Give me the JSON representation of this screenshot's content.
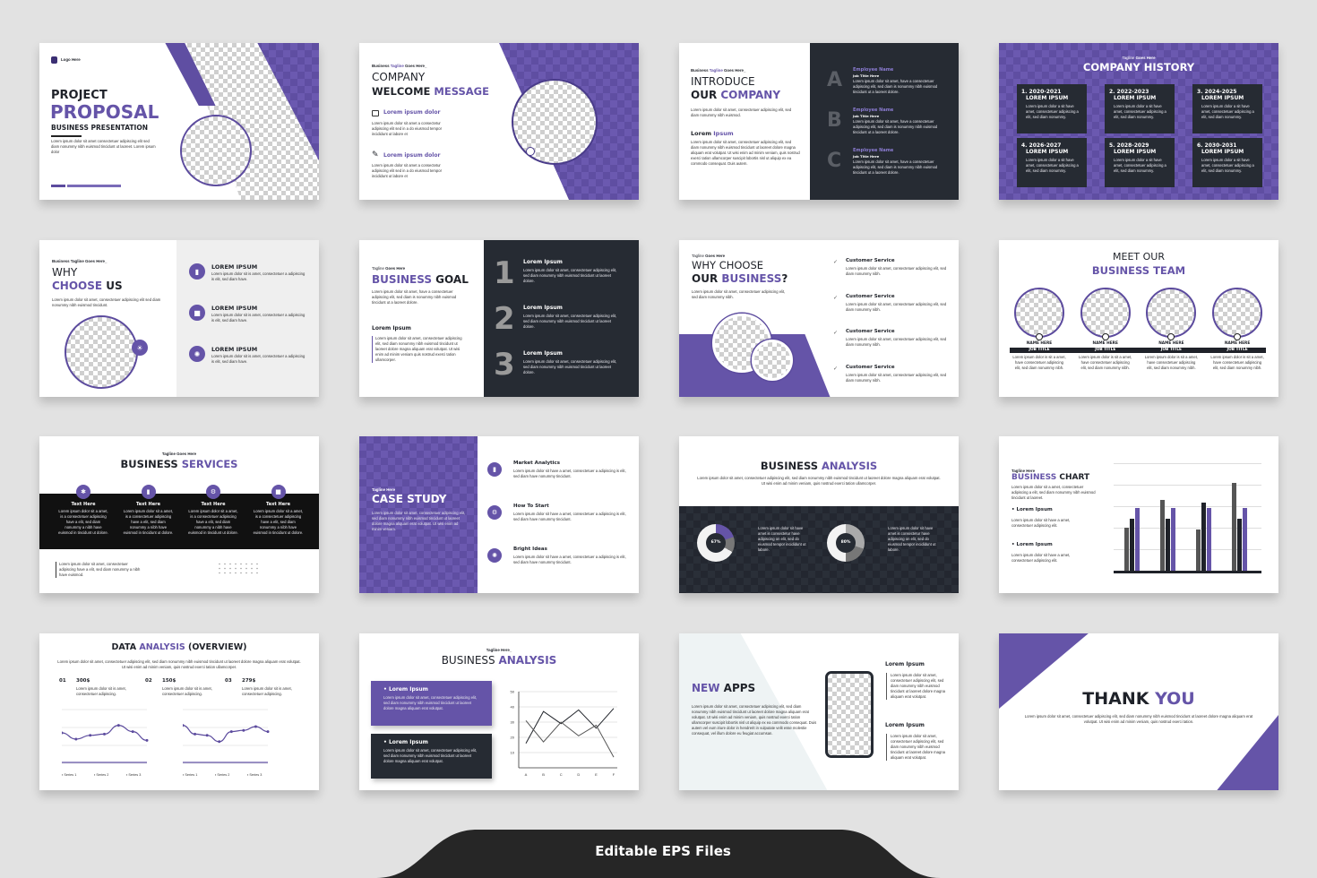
{
  "colors": {
    "accent": "#6554a8",
    "dark": "#262b33",
    "background": "#e2e2e2"
  },
  "footer": {
    "label": "Editable EPS Files"
  },
  "s1": {
    "logo": "Logo Here",
    "title1": "PROJECT",
    "title2": "PROPOSAL",
    "subtitle": "BUSINESS PRESENTATION",
    "body": "Lorem ipsum dolor sit amet consectetuer adipiscing elit sed diam nonummy nibh euismod tincidunt ut laoreet. Lorem ipsum dolor"
  },
  "s2": {
    "tag_a": "Business ",
    "tag_b": "Tagline",
    "tag_c": " Goes Here_",
    "title1": "COMPANY",
    "title2a": "WELCOME ",
    "title2b": "MESSAGE",
    "items": [
      {
        "icon": "message-icon",
        "heading": "Lorem ipsum dolor",
        "body": "Lorem ipsum dolor sit amet a consectetur adipiscing elit sed in a do eiusmod tempor incididunt ut labore et"
      },
      {
        "icon": "edit-icon",
        "heading": "Lorem ipsum dolor",
        "body": "Lorem ipsum dolor sit amet a consectetur adipiscing elit sed in a do eiusmod tempor incididunt ut labore et"
      }
    ]
  },
  "s3": {
    "tag_a": "Business ",
    "tag_b": "Tagline",
    "tag_c": " Goes Here_",
    "title1": "INTRODUCE",
    "title2a": "OUR ",
    "title2b": "COMPANY",
    "intro": "Lorem ipsum dolor sit amet, consectetuer adipiscing elit, sed diam nonummy nibh euismod.",
    "sub_a": "Lorem ",
    "sub_b": "Ipsum",
    "body": "Lorem ipsum dolor sit amet, consectetuer adipiscing elit, sed diam nonummy nibh euismod tincidunt ut laoreet dolore magna aliquam erat volutpat. Ut wisi enim ad minim veniam, quis nostrud exerci tation ullamcorper suscipit lobortis nisl ut aliquip ex ea commodo consequat. Duis autem.",
    "employees": [
      {
        "letter": "A",
        "name": "Employee Name",
        "job": "Job Title Here",
        "body": "Lorem ipsum dolor sit amet, have a consectetuer adipiscing elit, sed diam is nonummy nibh euismod tincidunt ut a laoreet dolore."
      },
      {
        "letter": "B",
        "name": "Employee Name",
        "job": "Job Title Here",
        "body": "Lorem ipsum dolor sit amet, have a consectetuer adipiscing elit, sed diam is nonummy nibh euismod tincidunt ut a laoreet dolore."
      },
      {
        "letter": "C",
        "name": "Employee Name",
        "job": "Job Title Here",
        "body": "Lorem ipsum dolor sit amet, have a consectetuer adipiscing elit, sed diam is nonummy nibh euismod tincidunt ut a laoreet dolore."
      }
    ]
  },
  "s4": {
    "tag_a": "Tagline ",
    "tag_b": "Goes Here",
    "title": "COMPANY HISTORY",
    "items": [
      {
        "year": "1. 2020-2021",
        "heading": "LOREM IPSUM",
        "body": "Lorem ipsum dolor a sit have amet, consectetuer adipiscing a elit, sed diam nonummy."
      },
      {
        "year": "2. 2022-2023",
        "heading": "LOREM IPSUM",
        "body": "Lorem ipsum dolor a sit have amet, consectetuer adipiscing a elit, sed diam nonummy."
      },
      {
        "year": "3. 2024-2025",
        "heading": "LOREM IPSUM",
        "body": "Lorem ipsum dolor a sit have amet, consectetuer adipiscing a elit, sed diam nonummy."
      },
      {
        "year": "4. 2026-2027",
        "heading": "LOREM IPSUM",
        "body": "Lorem ipsum dolor a sit have amet, consectetuer adipiscing a elit, sed diam nonummy."
      },
      {
        "year": "5. 2028-2029",
        "heading": "LOREM IPSUM",
        "body": "Lorem ipsum dolor a sit have amet, consectetuer adipiscing a elit, sed diam nonummy."
      },
      {
        "year": "6. 2030-2031",
        "heading": "LOREM IPSUM",
        "body": "Lorem ipsum dolor a sit have amet, consectetuer adipiscing a elit, sed diam nonummy."
      }
    ]
  },
  "s5": {
    "tag": "Business Tagline Goes Here_",
    "title1": "WHY",
    "title2a": "CHOOSE ",
    "title2b": "US",
    "body": "Lorem ipsum dolor sit amet, consectetuer adipiscing elit sed diam nonummy nibh euismod tincidunt.",
    "items": [
      {
        "icon": "chart-icon",
        "heading": "LOREM IPSUM",
        "body": "Lorem ipsum dolor sit is amet, consectetuer a adipiscing is elit, sed diam have."
      },
      {
        "icon": "briefcase-icon",
        "heading": "LOREM IPSUM",
        "body": "Lorem ipsum dolor sit is amet, consectetuer a adipiscing is elit, sed diam have."
      },
      {
        "icon": "lightbulb-icon",
        "heading": "LOREM IPSUM",
        "body": "Lorem ipsum dolor sit is amet, consectetuer a adipiscing is elit, sed diam have."
      }
    ]
  },
  "s6": {
    "tag_a": "Tagline ",
    "tag_b": "Goes Here",
    "title_a": "BUSINESS ",
    "title_b": "GOAL",
    "body": "Lorem ipsum dolor sit amet, have a consectetuer adipiscing elit, sed diam is nonummy nibh euismod tincidunt ut a laoreet dolore.",
    "sub": "Lorem Ipsum",
    "sub_body": "Lorem ipsum dolor sit amet, consectetuer adipiscing elit, sed diam nonummy nibh euismod tincidunt ut laoreet dolore magna aliquam erat volutpat. Ut wisi enim ad minim veniam quis nostrud exerci tation ullamcorper.",
    "items": [
      {
        "num": "1",
        "heading": "Lorem Ipsum",
        "body": "Lorem ipsum dolor sit amet, consectetuer adipiscing elit, sed diam nonummy nibh euismod tincidunt ut laoreet dolore."
      },
      {
        "num": "2",
        "heading": "Lorem Ipsum",
        "body": "Lorem ipsum dolor sit amet, consectetuer adipiscing elit, sed diam nonummy nibh euismod tincidunt ut laoreet dolore."
      },
      {
        "num": "3",
        "heading": "Lorem Ipsum",
        "body": "Lorem ipsum dolor sit amet, consectetuer adipiscing elit, sed diam nonummy nibh euismod tincidunt ut laoreet dolore."
      }
    ]
  },
  "s7": {
    "tag_a": "Tagline ",
    "tag_b": "Goes Here",
    "title1": "WHY CHOOSE",
    "title2a": "OUR ",
    "title2b": "BUSINESS",
    "title2c": "?",
    "body": "Lorem ipsum dolor sit amet, consectetuer adipiscing elit, sed diam nonummy nibh.",
    "items": [
      {
        "heading": "Customer Service",
        "body": "Lorem ipsum dolor sit amet, consectetuer adipiscing elit, sed diam nonummy nibh."
      },
      {
        "heading": "Customer Service",
        "body": "Lorem ipsum dolor sit amet, consectetuer adipiscing elit, sed diam nonummy nibh."
      },
      {
        "heading": "Customer Service",
        "body": "Lorem ipsum dolor sit amet, consectetuer adipiscing elit, sed diam nonummy nibh."
      },
      {
        "heading": "Customer Service",
        "body": "Lorem ipsum dolor sit amet, consectetuer adipiscing elit, sed diam nonummy nibh."
      }
    ]
  },
  "s8": {
    "title1": "MEET OUR",
    "title2": "BUSINESS TEAM",
    "members": [
      {
        "name": "NAME HERE",
        "job": "JOB TITLE",
        "body": "Lorem ipsum dolor is sit a amet, have consectetuer adipiscing elit, sed diam nonummy nibh."
      },
      {
        "name": "NAME HERE",
        "job": "JOB TITLE",
        "body": "Lorem ipsum dolor is sit a amet, have consectetuer adipiscing elit, sed diam nonummy nibh."
      },
      {
        "name": "NAME HERE",
        "job": "JOB TITLE",
        "body": "Lorem ipsum dolor is sit a amet, have consectetuer adipiscing elit, sed diam nonummy nibh."
      },
      {
        "name": "NAME HERE",
        "job": "JOB TITLE",
        "body": "Lorem ipsum dolor is sit a amet, have consectetuer adipiscing elit, sed diam nonummy nibh."
      }
    ]
  },
  "s9": {
    "tag": "Tagline Goes Here",
    "title_a": "BUSINESS ",
    "title_b": "SERVICES",
    "items": [
      {
        "icon": "virus-icon",
        "heading": "Text Here",
        "body": "Lorem ipsum dolor sit a amet, is a consectetuer adipiscing have a elit, sed diam nonummy a nibh have euismod in tincidunt ut dolore."
      },
      {
        "icon": "chart-icon",
        "heading": "Text Here",
        "body": "Lorem ipsum dolor sit a amet, is a consectetuer adipiscing have a elit, sed diam nonummy a nibh have euismod in tincidunt ut dolore."
      },
      {
        "icon": "gear-icon",
        "heading": "Text Here",
        "body": "Lorem ipsum dolor sit a amet, is a consectetuer adipiscing have a elit, sed diam nonummy a nibh have euismod in tincidunt ut dolore."
      },
      {
        "icon": "briefcase-icon",
        "heading": "Text Here",
        "body": "Lorem ipsum dolor sit a amet, is a consectetuer adipiscing have a elit, sed diam nonummy a nibh have euismod in tincidunt ut dolore."
      }
    ],
    "footer": "Lorem ipsum dolor sit amet, consectetuer adipiscing have a elit, sed diam nonummy a nibh have euismod."
  },
  "s10": {
    "tag": "Tagline Here",
    "title": "CASE STUDY",
    "body": "Lorem ipsum dolor sit amet, consectetuer adipiscing elit, sed diam nonummy nibh euismod tincidunt ut laoreet dolore magna aliquam erat volutpat. Ut wisi enim ad minim veniam.",
    "items": [
      {
        "icon": "chart-icon",
        "heading": "Market Analytics",
        "body": "Lorem ipsum dolor sit have a amet, consectetuer a adipiscing is elit, sed diam have nonummy tincidunt."
      },
      {
        "icon": "gear-icon",
        "heading": "How To Start",
        "body": "Lorem ipsum dolor sit have a amet, consectetuer a adipiscing is elit, sed diam have nonummy tincidunt."
      },
      {
        "icon": "lightbulb-icon",
        "heading": "Bright Ideas",
        "body": "Lorem ipsum dolor sit have a amet, consectetuer a adipiscing is elit, sed diam have nonummy tincidunt."
      }
    ]
  },
  "s11": {
    "title_a": "BUSINESS ",
    "title_b": "ANALYSIS",
    "body": "Lorem ipsum dolor sit amet, consectetuer adipiscing elit, sed diam nonummy nibh euismod tincidunt ut laoreet dolore magna aliquam erat volutpat. Ut wisi enim ad minim veniam, quis nostrud exerci tation ullamcorper.",
    "donuts": [
      {
        "label": "67%",
        "percent": 67,
        "body": "Lorem ipsum dolor sit have amet is consectetur have adipiscing on elit, sed do eiusmod tempor incididunt ut labore."
      },
      {
        "label": "80%",
        "percent": 80,
        "body": "Lorem ipsum dolor sit have amet is consectetur have adipiscing on elit, sed do eiusmod tempor incididunt ut labore."
      }
    ]
  },
  "s12": {
    "tag": "Tagline Here",
    "title_a": "BUSINESS ",
    "title_b": "CHART",
    "body": "Lorem ipsum dolor sit a amet, consectetuer adipiscing a elit, sed diam nonummy nibh euismod tincidunt ut laoreet.",
    "items": [
      {
        "heading": "Lorem Ipsum",
        "body": "Lorem ipsum dolor sit have a amet, consectetuer adipiscing elit."
      },
      {
        "heading": "Lorem Ipsum",
        "body": "Lorem ipsum dolor sit have a amet, consectetuer adipiscing elit."
      }
    ]
  },
  "s13": {
    "title_a": "DATA ",
    "title_b": "ANALYSIS",
    "title_c": " (OVERVIEW)",
    "body": "Lorem ipsum dolor sit amet, consectetuer adipiscing elit, sed diam nonummy nibh euismod tincidunt ut laoreet dolore magna aliquam erat volutpat. Ut wisi enim ad minim veniam, quis nostrud exerci tation ullamcorper.",
    "stats": [
      {
        "num": "01",
        "value": "300$",
        "body": "Lorem ipsum dolor sit is amet, consectetuer adipiscing."
      },
      {
        "num": "02",
        "value": "150$",
        "body": "Lorem ipsum dolor sit is amet, consectetuer adipiscing."
      },
      {
        "num": "03",
        "value": "279$",
        "body": "Lorem ipsum dolor sit is amet, consectetuer adipiscing."
      }
    ]
  },
  "s14": {
    "tag": "Tagline Here_",
    "title_a": "BUSINESS ",
    "title_b": "ANALYSIS",
    "boxes": [
      {
        "heading": "Lorem Ipsum",
        "body": "Lorem ipsum dolor sit amet, consectetuer adipiscing elit, sed diam nonummy nibh euismod tincidunt ut laoreet dolore magna aliquam erat volutpat."
      },
      {
        "heading": "Lorem Ipsum",
        "body": "Lorem ipsum dolor sit amet, consectetuer adipiscing elit, sed diam nonummy nibh euismod tincidunt ut laoreet dolore magna aliquam erat volutpat."
      }
    ]
  },
  "s15": {
    "title_a": "NEW ",
    "title_b": "APPS",
    "body": "Lorem ipsum dolor sit amet, consectetuer adipiscing elit, sed diam nonummy nibh euismod tincidunt ut laoreet dolore magna aliquam erat volutpat. Ut wisi enim ad minim veniam, quis nostrud exerci tation ullamcorper suscipit lobortis nisl ut aliquip ex ea commodo consequat. Duis autem vel eum iriure dolor in hendrerit in vulputate velit esse molestie consequat, vel illum dolore eu feugiat accumsan.",
    "items": [
      {
        "heading": "Lorem Ipsum",
        "body": "Lorem ipsum dolor sit amet, consectetuer adipiscing elit, sed diam nonummy nibh euismod tincidunt ut laoreet dolore magna aliquam erat volutpat."
      },
      {
        "heading": "Lorem Ipsum",
        "body": "Lorem ipsum dolor sit amet, consectetuer adipiscing elit, sed diam nonummy nibh euismod tincidunt ut laoreet dolore magna aliquam erat volutpat."
      }
    ]
  },
  "s16": {
    "title_a": "THANK ",
    "title_b": "YOU",
    "body": "Lorem ipsum dolor sit amet, consectetuer adipiscing elit, sed diam nonummy nibh euismod tincidunt ut laoreet dolore magna aliquam erat volutpat. Ut wisi enim ad minim veniam, quis nostrud exerci tation."
  },
  "chart_data": [
    {
      "id": "business-chart",
      "type": "bar",
      "ylim": [
        0,
        100
      ],
      "grid": true,
      "series": [
        {
          "color": "#555555",
          "values": [
            40,
            66,
            38,
            82
          ]
        },
        {
          "color": "#1f2229",
          "values": [
            48,
            48,
            63,
            48
          ]
        },
        {
          "color": "#6554a8",
          "values": [
            58,
            58,
            58,
            58
          ]
        }
      ]
    },
    {
      "id": "analysis-line",
      "type": "line",
      "categories": [
        "A",
        "B",
        "C",
        "D",
        "E",
        "F"
      ],
      "yticks": [
        10,
        20,
        30,
        40,
        50
      ],
      "ylim": [
        0,
        50
      ],
      "grid": true,
      "series": [
        {
          "color": "#1f2229",
          "values": [
            16,
            37,
            29,
            38,
            26,
            39
          ]
        },
        {
          "color": "#555555",
          "values": [
            31,
            17,
            30,
            21,
            28,
            7
          ]
        }
      ]
    },
    {
      "id": "overview-line-1",
      "type": "line",
      "legend": [
        "Series 1",
        "Series 2",
        "Series 3"
      ],
      "values": [
        20,
        15,
        18,
        19,
        26,
        21,
        14
      ]
    },
    {
      "id": "overview-line-2",
      "type": "line",
      "legend": [
        "Series 1",
        "Series 2",
        "Series 3"
      ],
      "values": [
        26,
        19,
        18,
        13,
        21,
        22,
        25,
        21
      ]
    }
  ]
}
